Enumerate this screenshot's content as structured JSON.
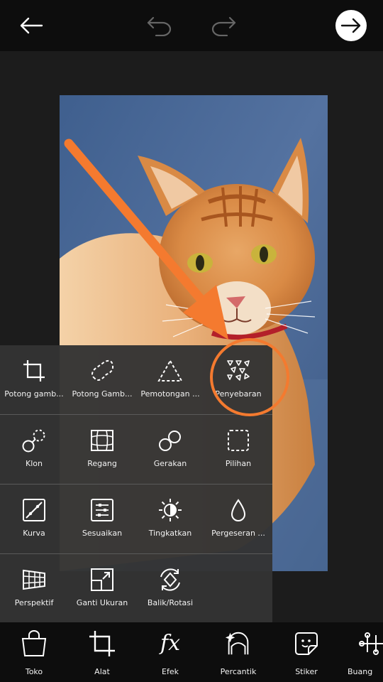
{
  "topbar": {
    "back_icon": "arrow-left-icon",
    "undo_icon": "undo-icon",
    "redo_icon": "redo-icon",
    "next_icon": "arrow-right-icon"
  },
  "photo": {
    "subject": "orange tabby cat on blue background"
  },
  "tools": {
    "rows": [
      [
        {
          "label": "Potong gamb...",
          "icon": "crop-icon"
        },
        {
          "label": "Potong Gamb...",
          "icon": "freecrop-icon"
        },
        {
          "label": "Pemotongan ...",
          "icon": "shape-crop-icon"
        },
        {
          "label": "Penyebaran",
          "icon": "dispersion-icon"
        }
      ],
      [
        {
          "label": "Klon",
          "icon": "clone-icon"
        },
        {
          "label": "Regang",
          "icon": "stretch-icon"
        },
        {
          "label": "Gerakan",
          "icon": "motion-icon"
        },
        {
          "label": "Pilihan",
          "icon": "selection-icon"
        }
      ],
      [
        {
          "label": "Kurva",
          "icon": "curves-icon"
        },
        {
          "label": "Sesuaikan",
          "icon": "adjust-icon"
        },
        {
          "label": "Tingkatkan",
          "icon": "enhance-icon"
        },
        {
          "label": "Pergeseran ...",
          "icon": "tilt-shift-icon"
        }
      ],
      [
        {
          "label": "Perspektif",
          "icon": "perspective-icon"
        },
        {
          "label": "Ganti Ukuran",
          "icon": "resize-icon"
        },
        {
          "label": "Balik/Rotasi",
          "icon": "flip-rotate-icon"
        }
      ]
    ]
  },
  "annotation": {
    "color": "#f47a2f"
  },
  "bottombar": {
    "items": [
      {
        "label": "Toko",
        "icon": "shop-bag-icon"
      },
      {
        "label": "Alat",
        "icon": "crop-tool-icon"
      },
      {
        "label": "Efek",
        "icon": "fx-icon"
      },
      {
        "label": "Percantik",
        "icon": "beautify-face-icon"
      },
      {
        "label": "Stiker",
        "icon": "sticker-icon"
      },
      {
        "label": "Buang",
        "icon": "remove-icon"
      }
    ]
  }
}
